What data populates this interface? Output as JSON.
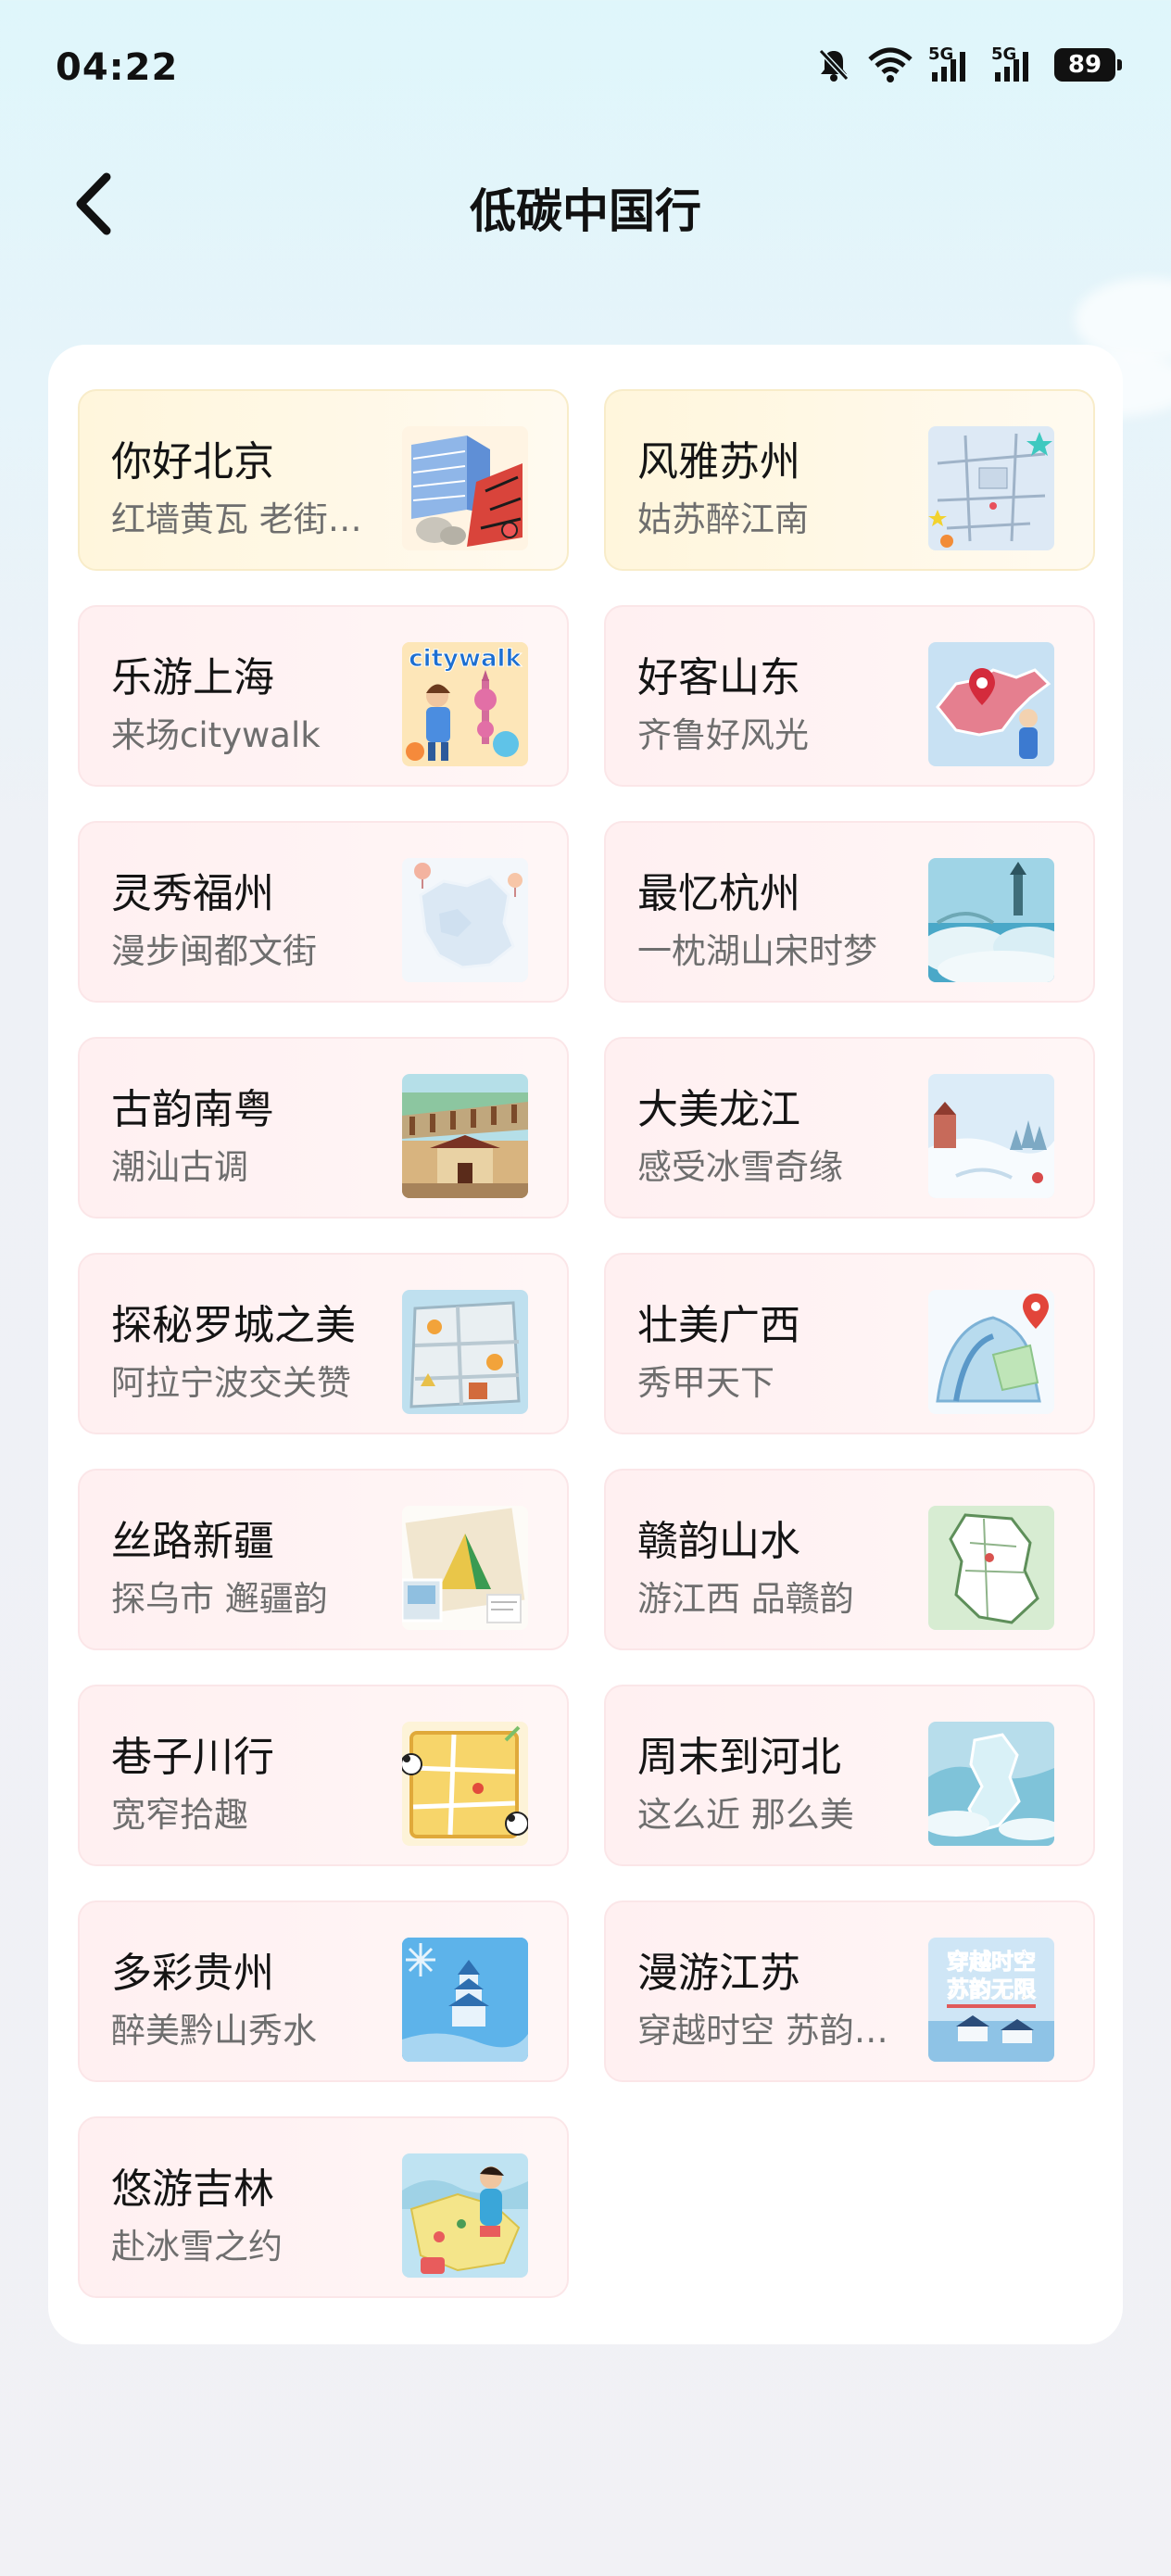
{
  "status_bar": {
    "time": "04:22",
    "network_1": "5G",
    "network_2": "5G",
    "battery": "89",
    "icons": [
      "bell-off-icon",
      "wifi-icon",
      "signal-5g-icon",
      "signal-5g-icon",
      "battery-icon"
    ]
  },
  "nav": {
    "back_icon": "chevron-left-icon",
    "title": "低碳中国行"
  },
  "colors": {
    "card_pink": "#fff0f1",
    "card_gold": "#fff6dc",
    "title_text": "#141414",
    "sub_text": "#6e6e6e"
  },
  "cards": [
    {
      "title": "你好北京",
      "subtitle": "红墙黄瓦 老街…",
      "thumb": "beijing-thumbnail"
    },
    {
      "title": "风雅苏州",
      "subtitle": "姑苏醉江南",
      "thumb": "suzhou-map-thumbnail"
    },
    {
      "title": "乐游上海",
      "subtitle": "来场citywalk",
      "thumb": "shanghai-citywalk-thumbnail",
      "thumb_text": "citywalk"
    },
    {
      "title": "好客山东",
      "subtitle": "齐鲁好风光",
      "thumb": "shandong-map-thumbnail"
    },
    {
      "title": "灵秀福州",
      "subtitle": "漫步闽都文街",
      "thumb": "fuzhou-map-thumbnail"
    },
    {
      "title": "最忆杭州",
      "subtitle": "一枕湖山宋时梦",
      "thumb": "hangzhou-thumbnail"
    },
    {
      "title": "古韵南粤",
      "subtitle": "潮汕古调",
      "thumb": "chaoshan-thumbnail"
    },
    {
      "title": "大美龙江",
      "subtitle": "感受冰雪奇缘",
      "thumb": "heilongjiang-snow-thumbnail"
    },
    {
      "title": "探秘罗城之美",
      "subtitle": "阿拉宁波交关赞",
      "thumb": "ningbo-map-thumbnail"
    },
    {
      "title": "壮美广西",
      "subtitle": "秀甲天下",
      "thumb": "guangxi-thumbnail"
    },
    {
      "title": "丝路新疆",
      "subtitle": "探乌市 邂疆韵",
      "thumb": "xinjiang-thumbnail"
    },
    {
      "title": "赣韵山水",
      "subtitle": "游江西 品赣韵",
      "thumb": "jiangxi-map-thumbnail"
    },
    {
      "title": "巷子川行",
      "subtitle": "宽窄拾趣",
      "thumb": "sichuan-map-thumbnail"
    },
    {
      "title": "周末到河北",
      "subtitle": "这么近 那么美",
      "thumb": "hebei-map-thumbnail"
    },
    {
      "title": "多彩贵州",
      "subtitle": "醉美黔山秀水",
      "thumb": "guizhou-thumbnail"
    },
    {
      "title": "漫游江苏",
      "subtitle": "穿越时空 苏韵…",
      "thumb": "jiangsu-poster-thumbnail",
      "thumb_text_1": "穿越时空",
      "thumb_text_2": "苏韵无限"
    },
    {
      "title": "悠游吉林",
      "subtitle": "赴冰雪之约",
      "thumb": "jilin-thumbnail"
    }
  ]
}
